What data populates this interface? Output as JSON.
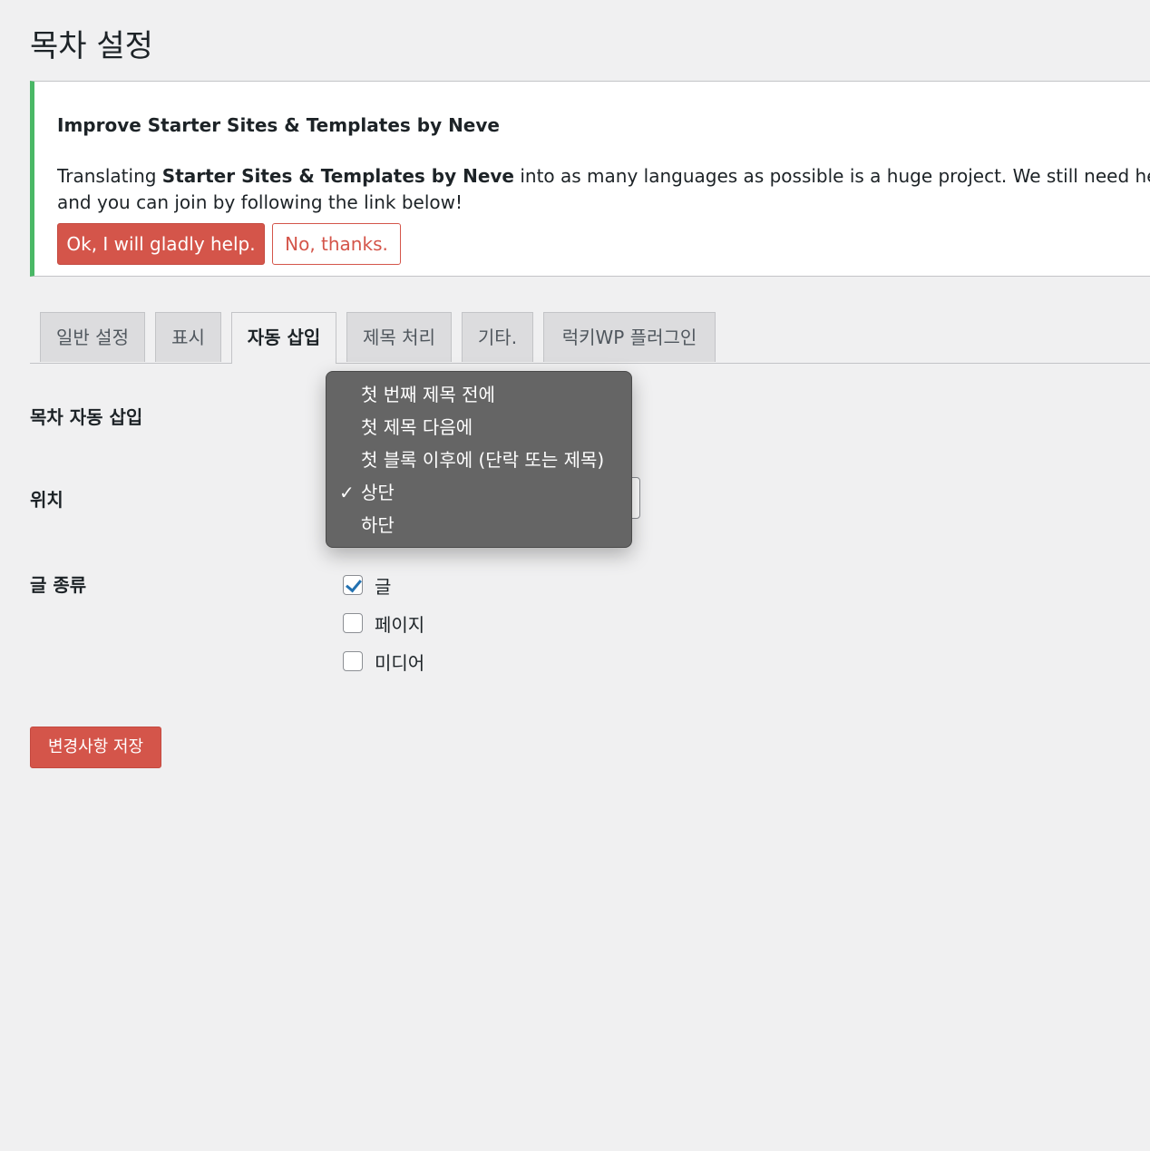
{
  "page": {
    "title": "목차 설정"
  },
  "notice": {
    "heading": "Improve Starter Sites & Templates by Neve",
    "text_prefix": "Translating ",
    "text_bold": "Starter Sites & Templates by Neve",
    "text_suffix": " into as many languages as possible is a huge project. We still need help with a l",
    "text_line2": "and you can join by following the link below!",
    "accept_label": "Ok, I will gladly help.",
    "decline_label": "No, thanks.",
    "accent_color": "#4ab866"
  },
  "tabs": [
    {
      "label": "일반 설정",
      "active": false
    },
    {
      "label": "표시",
      "active": false
    },
    {
      "label": "자동 삽입",
      "active": true
    },
    {
      "label": "제목 처리",
      "active": false
    },
    {
      "label": "기타.",
      "active": false
    },
    {
      "label": "럭키WP 플러그인",
      "active": false
    }
  ],
  "form": {
    "auto_insert_label": "목차 자동 삽입",
    "position_label": "위치",
    "post_types_label": "글 종류",
    "post_types": [
      {
        "label": "글",
        "checked": true
      },
      {
        "label": "페이지",
        "checked": false
      },
      {
        "label": "미디어",
        "checked": false
      }
    ],
    "save_label": "변경사항 저장"
  },
  "position_dropdown": {
    "options": [
      "첫 번째 제목 전에",
      "첫 제목 다음에",
      "첫 블록 이후에 (단락 또는 제목)",
      "상단",
      "하단"
    ],
    "selected": "상단",
    "check_mark": "✓"
  },
  "colors": {
    "primary_button": "#d4554a",
    "dropdown_bg": "#656565",
    "page_bg": "#f0f0f1"
  }
}
